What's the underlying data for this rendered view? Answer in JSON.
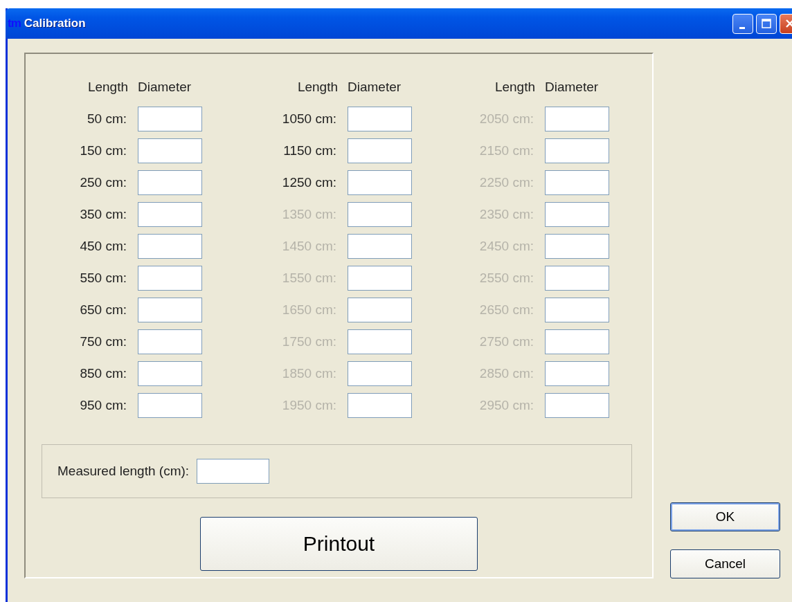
{
  "window": {
    "logo": "tm",
    "title": "Calibration"
  },
  "calibration": {
    "groups": [
      {
        "headers": [
          "Length",
          "Diameter"
        ],
        "rows": [
          {
            "label": "50 cm:",
            "disabled": false
          },
          {
            "label": "150 cm:",
            "disabled": false
          },
          {
            "label": "250 cm:",
            "disabled": false
          },
          {
            "label": "350 cm:",
            "disabled": false
          },
          {
            "label": "450 cm:",
            "disabled": false
          },
          {
            "label": "550 cm:",
            "disabled": false
          },
          {
            "label": "650 cm:",
            "disabled": false
          },
          {
            "label": "750 cm:",
            "disabled": false
          },
          {
            "label": "850 cm:",
            "disabled": false
          },
          {
            "label": "950 cm:",
            "disabled": false
          }
        ]
      },
      {
        "headers": [
          "Length",
          "Diameter"
        ],
        "rows": [
          {
            "label": "1050 cm:",
            "disabled": false
          },
          {
            "label": "1150 cm:",
            "disabled": false
          },
          {
            "label": "1250 cm:",
            "disabled": false
          },
          {
            "label": "1350 cm:",
            "disabled": true
          },
          {
            "label": "1450 cm:",
            "disabled": true
          },
          {
            "label": "1550 cm:",
            "disabled": true
          },
          {
            "label": "1650 cm:",
            "disabled": true
          },
          {
            "label": "1750 cm:",
            "disabled": true
          },
          {
            "label": "1850 cm:",
            "disabled": true
          },
          {
            "label": "1950 cm:",
            "disabled": true
          }
        ]
      },
      {
        "headers": [
          "Length",
          "Diameter"
        ],
        "rows": [
          {
            "label": "2050 cm:",
            "disabled": true
          },
          {
            "label": "2150 cm:",
            "disabled": true
          },
          {
            "label": "2250 cm:",
            "disabled": true
          },
          {
            "label": "2350 cm:",
            "disabled": true
          },
          {
            "label": "2450 cm:",
            "disabled": true
          },
          {
            "label": "2550 cm:",
            "disabled": true
          },
          {
            "label": "2650 cm:",
            "disabled": true
          },
          {
            "label": "2750 cm:",
            "disabled": true
          },
          {
            "label": "2850 cm:",
            "disabled": true
          },
          {
            "label": "2950 cm:",
            "disabled": true
          }
        ]
      }
    ]
  },
  "measured_length": {
    "label": "Measured length (cm):"
  },
  "printout_button": "Printout",
  "buttons": [
    "OK",
    "Cancel"
  ]
}
